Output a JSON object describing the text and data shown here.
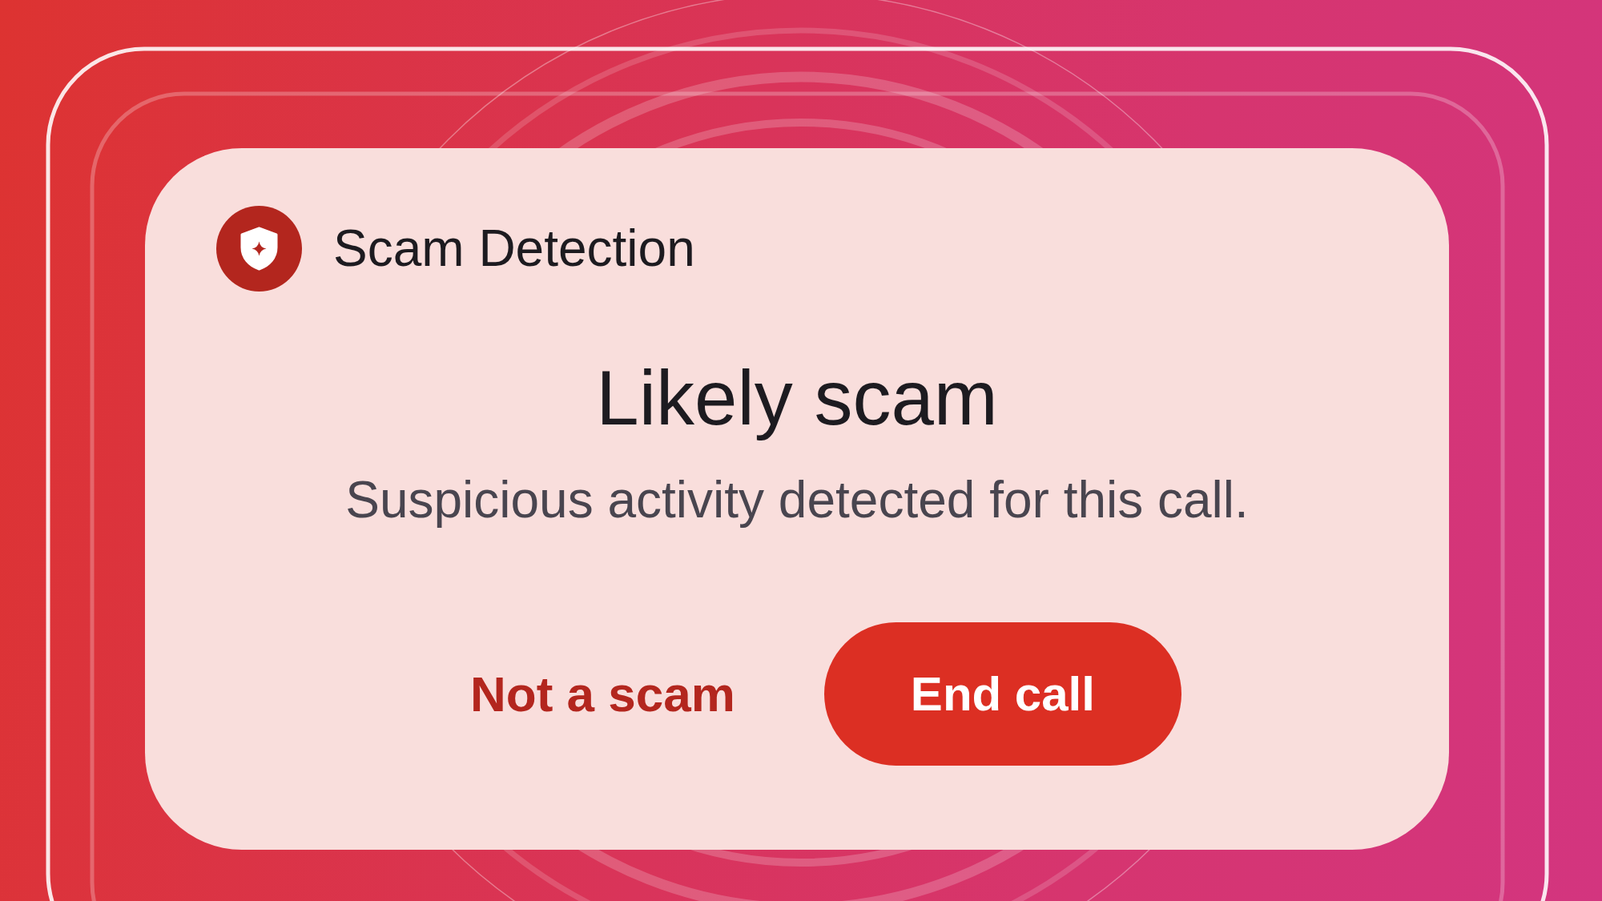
{
  "notification": {
    "app_name": "Scam Detection"
  },
  "alert": {
    "title": "Likely scam",
    "message": "Suspicious activity detected for this call."
  },
  "actions": [
    {
      "label": "Not a scam",
      "kind": "text"
    },
    {
      "label": "End call",
      "kind": "filled"
    }
  ]
}
